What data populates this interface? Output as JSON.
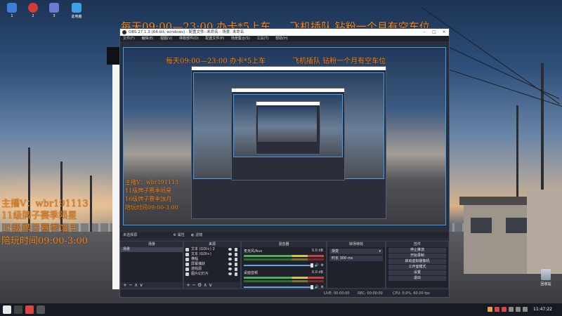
{
  "overlay": {
    "top_left": "每天09:00—23:00 办卡*5上车",
    "top_right": "飞机插队   钻粉一个月有空车位",
    "side_lines": [
      "主播V：wbr191113",
      "11级牌子赛季陨星",
      "16级牌子赛季蚀月",
      "陪玩时间09:00-3:00"
    ],
    "nested_top_left": "每天09:00—23:00 办卡*5上车",
    "nested_top_right": "飞机插队   钻粉一个月有空车位",
    "nested_side_lines": [
      "主播V：wbr191113",
      "11级牌子赛季陨星",
      "16级牌子赛季蚀月",
      "陪玩时间09:00-3:00"
    ]
  },
  "desktop_icons": [
    {
      "label": "1",
      "color": "#3b7fd6"
    },
    {
      "label": "2",
      "color": "#d63b3b"
    },
    {
      "label": "3",
      "color": "#6a7bd6"
    },
    {
      "label": "此电脑",
      "color": "#3fa0e6"
    }
  ],
  "recycle_bin": "回收站",
  "obs": {
    "title": "OBS 27.1.3 (64-bit, windows) - 配置文件: 未命名 - 场景: 未命名",
    "menu": [
      "文件(F)",
      "编辑(E)",
      "视图(V)",
      "停靠部件(D)",
      "配置文件(P)",
      "场景集合(S)",
      "工具(T)",
      "帮助(H)"
    ],
    "no_source": "未选择源",
    "properties": "属性",
    "filters": "滤镜",
    "panels": {
      "scenes": {
        "title": "场景",
        "items": [
          "场景"
        ]
      },
      "sources": {
        "title": "来源",
        "items": [
          "文本 (GDI+) 2",
          "文本 (GDI+)",
          "横幅",
          "屏幕捕获",
          "游戏源",
          "图片幻灯片"
        ]
      },
      "mixer": {
        "title": "混音器",
        "channels": [
          {
            "name": "桌面音频",
            "level": "0.0 dB"
          },
          {
            "name": "麦克风/Aux",
            "level": "0.0 dB"
          }
        ]
      },
      "transitions": {
        "title": "转场特效",
        "type": "渐变",
        "duration_label": "时长",
        "duration": "300 ms"
      },
      "controls": {
        "title": "控件",
        "buttons": [
          "停止推流",
          "开始录制",
          "启动虚拟摄像机",
          "工作室模式",
          "设置",
          "退出"
        ]
      }
    },
    "footer_add": "+  −  ∧  ∨",
    "status": {
      "live": "LIVE: 00:00:00",
      "rec": "REC: 00:00:00",
      "cpu": "CPU: 0.0%, 60.00 fps"
    }
  },
  "taskbar": {
    "time": "11:47:22"
  }
}
